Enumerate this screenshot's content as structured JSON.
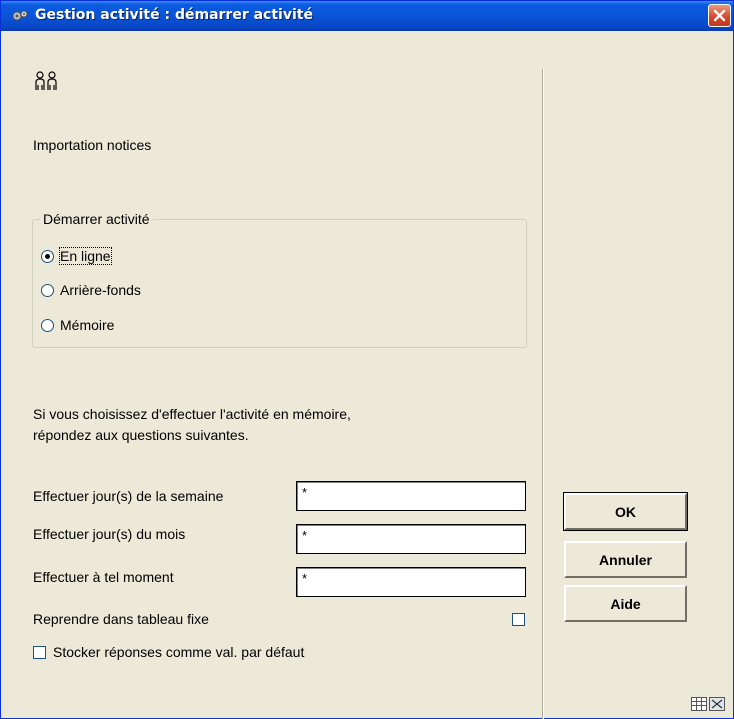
{
  "window": {
    "title": "Gestion activité : démarrer activité"
  },
  "activity_label": "Importation notices",
  "start_group": {
    "legend": "Démarrer activité",
    "options": [
      {
        "label": "En ligne",
        "checked": true
      },
      {
        "label": "Arrière-fonds",
        "checked": false
      },
      {
        "label": "Mémoire",
        "checked": false
      }
    ]
  },
  "info": {
    "line1": "Si vous choisissez d'effectuer l'activité en mémoire,",
    "line2": "répondez aux questions suivantes."
  },
  "fields": {
    "weekdays_label": "Effectuer jour(s) de la semaine",
    "weekdays_value": "*",
    "monthdays_label": "Effectuer jour(s) du mois",
    "monthdays_value": "*",
    "time_label": "Effectuer à tel moment",
    "time_value": "*",
    "fixed_table_label": "Reprendre dans tableau fixe",
    "store_defaults_label": "Stocker réponses comme val. par défaut"
  },
  "buttons": {
    "ok": "OK",
    "cancel": "Annuler",
    "help": "Aide"
  },
  "icons": [
    "settings-icon",
    "close-icon",
    "people-icon",
    "grid-icon",
    "resize-icon"
  ],
  "colors": {
    "titlebar": "#0a54d8",
    "window_bg": "#ece9d8",
    "close_button": "#d6452a"
  }
}
